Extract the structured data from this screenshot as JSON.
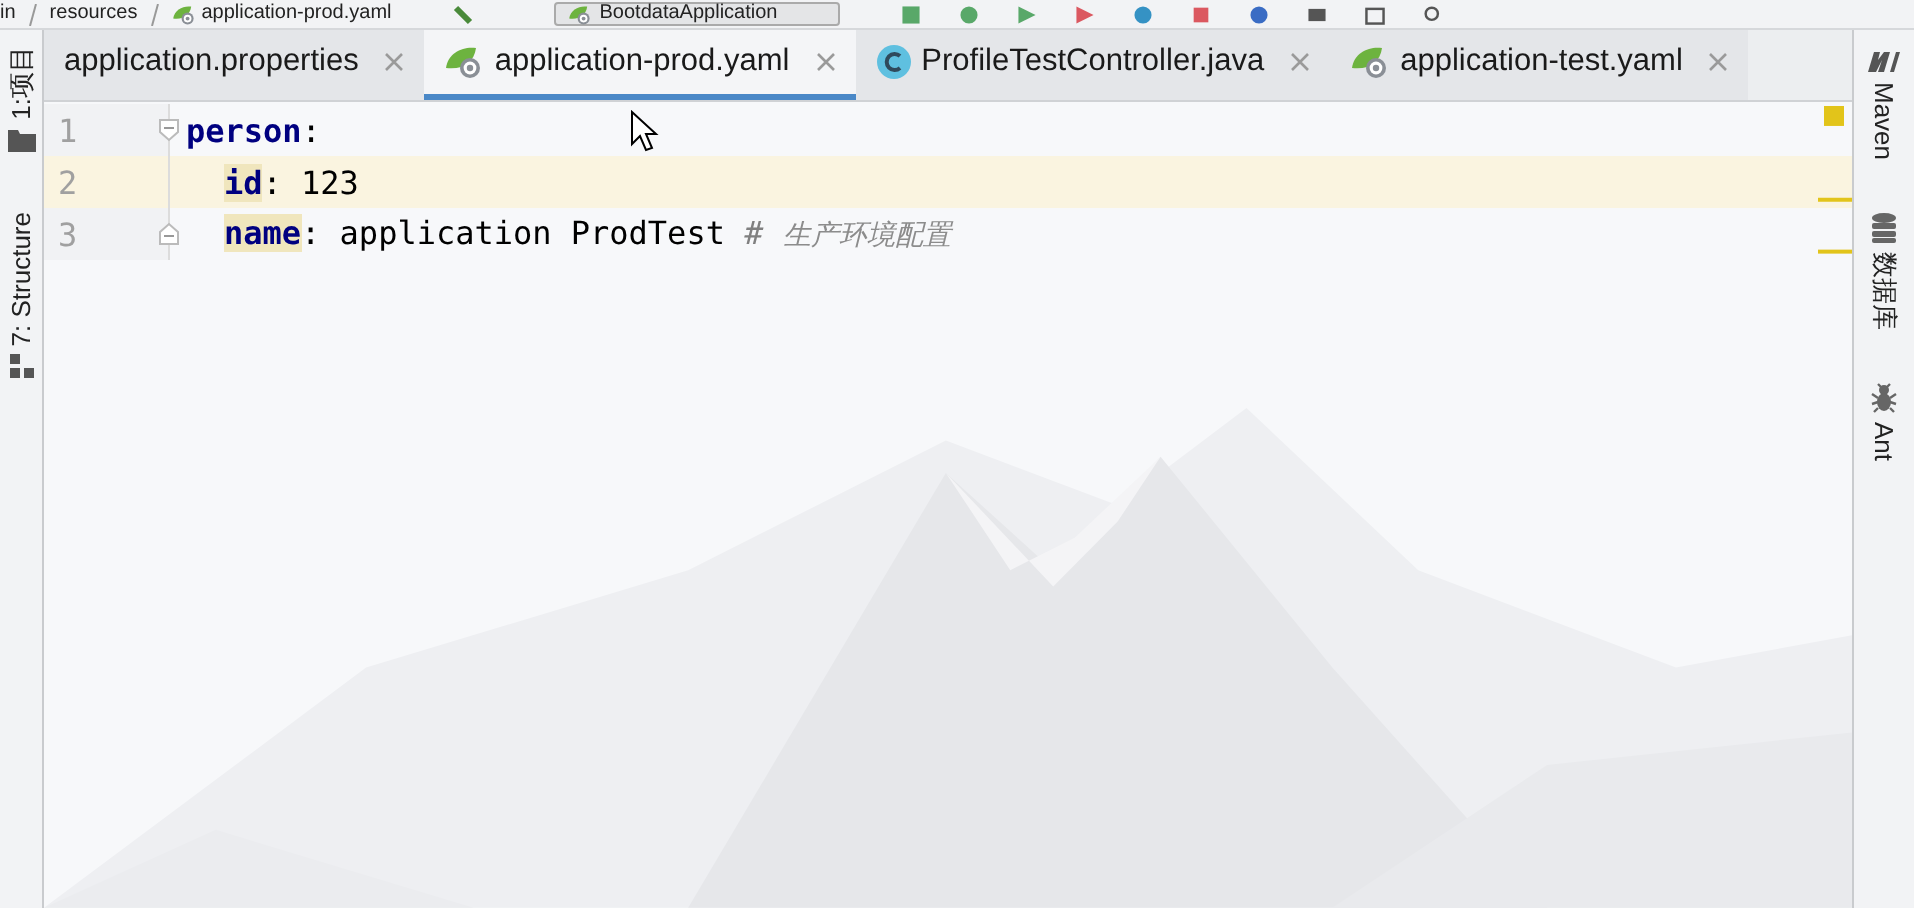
{
  "toolbar": {
    "breadcrumbs": [
      "in",
      "resources",
      "application-prod.yaml"
    ],
    "run_config": "BootdataApplication"
  },
  "tabs": [
    {
      "label": "application.properties",
      "kind": "properties",
      "selected": false
    },
    {
      "label": "application-prod.yaml",
      "kind": "spring",
      "selected": true
    },
    {
      "label": "ProfileTestController.java",
      "kind": "class",
      "selected": false
    },
    {
      "label": "application-test.yaml",
      "kind": "spring",
      "selected": false
    }
  ],
  "left_strip": [
    "1:项目",
    "7: Structure"
  ],
  "right_strip": [
    {
      "label": "Maven",
      "kind": "maven"
    },
    {
      "label": "数据库",
      "kind": "database"
    },
    {
      "label": "Ant",
      "kind": "ant"
    }
  ],
  "editor": {
    "lines": [
      {
        "number": "1",
        "current": false,
        "fold_start": true,
        "fold_end": false,
        "indent": false,
        "tokens": [
          {
            "text": "person",
            "kind": "key",
            "highlighted": false
          },
          {
            "text": ":",
            "kind": "punct"
          }
        ]
      },
      {
        "number": "2",
        "current": true,
        "fold_start": false,
        "fold_end": false,
        "indent": true,
        "tokens": [
          {
            "text": "id",
            "kind": "key",
            "highlighted": true
          },
          {
            "text": ": ",
            "kind": "punct"
          },
          {
            "text": "123",
            "kind": "value"
          }
        ]
      },
      {
        "number": "3",
        "current": false,
        "fold_start": false,
        "fold_end": true,
        "indent": true,
        "tokens": [
          {
            "text": "name",
            "kind": "key",
            "highlighted": true
          },
          {
            "text": ": ",
            "kind": "punct"
          },
          {
            "text": "application ProdTest ",
            "kind": "value"
          },
          {
            "text": "# ",
            "kind": "comment-mark"
          },
          {
            "text": "生产环境配置",
            "kind": "comment"
          }
        ]
      }
    ]
  }
}
